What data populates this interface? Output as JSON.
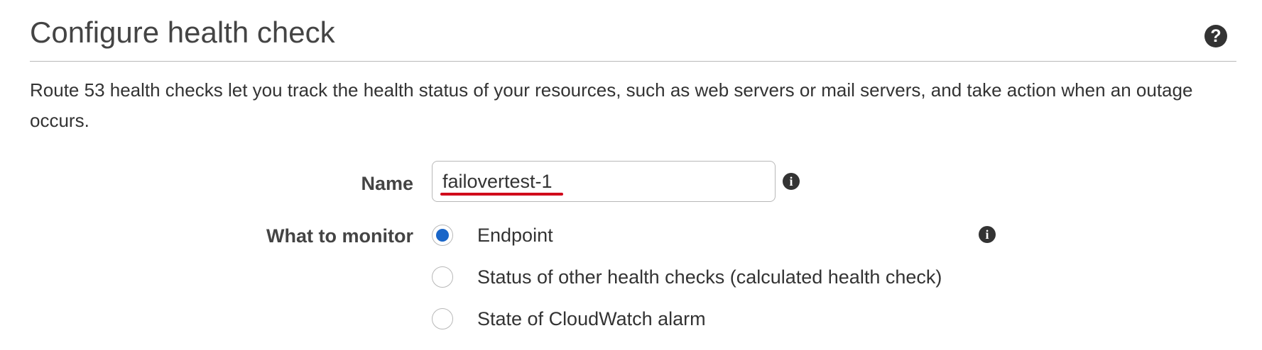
{
  "header": {
    "title": "Configure health check",
    "help_icon": "question-circle-icon",
    "help_symbol": "?"
  },
  "description": "Route 53 health checks let you track the health status of your resources, such as web servers or mail servers, and take action when an outage occurs.",
  "form": {
    "name": {
      "label": "Name",
      "value": "failovertest-1",
      "info_icon": "info-circle-icon",
      "info_symbol": "i"
    },
    "monitor": {
      "label": "What to monitor",
      "info_icon": "info-circle-icon",
      "info_symbol": "i",
      "options": [
        {
          "label": "Endpoint",
          "selected": true
        },
        {
          "label": "Status of other health checks (calculated health check)",
          "selected": false
        },
        {
          "label": "State of CloudWatch alarm",
          "selected": false
        }
      ]
    }
  },
  "colors": {
    "accent": "#1a66c8",
    "annotation_underline": "#d0021b",
    "text": "#333333",
    "divider": "#b8b8b8"
  }
}
